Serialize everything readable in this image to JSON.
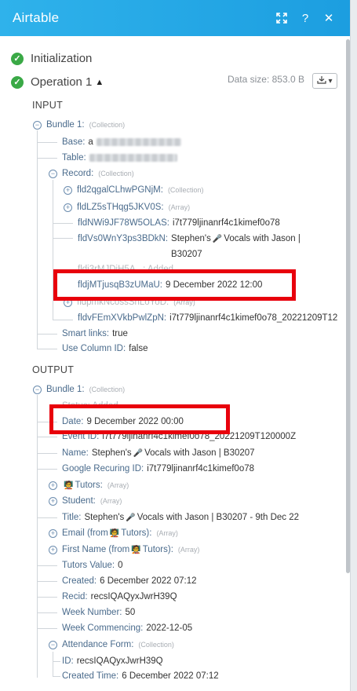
{
  "titlebar": {
    "title": "Airtable",
    "expand_icon": "expand-icon",
    "help_label": "?",
    "close_label": "✕"
  },
  "initialization": "Initialization",
  "operation": {
    "label": "Operation 1",
    "caret": "▲",
    "datasize": "Data size: 853.0 B"
  },
  "input": {
    "header": "INPUT",
    "bundle": "Bundle 1:",
    "collection": "(Collection)",
    "array": "(Array)",
    "base_key": "Base:",
    "base_val": "a",
    "table_key": "Table:",
    "record": "Record:",
    "f1": "fld2qgalCLhwPGNjM:",
    "f2": "fldLZ5sTHqg5JKV0S:",
    "f3_key": "fldNWi9JF78W5OLAS:",
    "f3_val": "i7t779ljinanrf4c1kimef0o78",
    "f4_key": "fldVs0WnY3ps3BDkN:",
    "f4_val1": "Stephen's",
    "f4_val2": "Vocals with Jason |",
    "f4_val3": "B30207",
    "f5_ghost": "fldi3rMJDiH5A...: Added",
    "f6_key": "fldjMTjusqB3zUMaU:",
    "f6_val": "9 December 2022 12:00",
    "f7_ghost": "fldpmkNcossShLoYoD:",
    "f8_key": "fldvFEmXVkbPwlZpN:",
    "f8_val": "i7t779ljinanrf4c1kimef0o78_20221209T12",
    "smart_key": "Smart links:",
    "smart_val": "true",
    "usecol_key": "Use Column ID:",
    "usecol_val": "false"
  },
  "output": {
    "header": "OUTPUT",
    "bundle": "Bundle 1:",
    "collection": "(Collection)",
    "array": "(Array)",
    "status_ghost": "Status: Added",
    "date_key": "Date:",
    "date_val": "9 December 2022 00:00",
    "event_key": "Event ID:",
    "event_val": "i7t779ljinanrf4c1kimef0o78_20221209T120000Z",
    "name_key": "Name:",
    "name_val1": "Stephen's",
    "name_val2": "Vocals with Jason | B30207",
    "grec_key": "Google Recuring ID:",
    "grec_val": "i7t779ljinanrf4c1kimef0o78",
    "tutors_key": "Tutors:",
    "student_key": "Student:",
    "title_key": "Title:",
    "title_val1": "Stephen's",
    "title_val2": "Vocals with Jason | B30207 - 9th Dec 22",
    "email_key1": "Email (from",
    "email_key2": "Tutors):",
    "fname_key1": "First Name (from",
    "fname_key2": "Tutors):",
    "tval_key": "Tutors Value:",
    "tval_val": "0",
    "created_key": "Created:",
    "created_val": "6 December 2022 07:12",
    "recid_key": "Recid:",
    "recid_val": "recsIQAQyxJwrH39Q",
    "week_key": "Week Number:",
    "week_val": "50",
    "weekc_key": "Week Commencing:",
    "weekc_val": "2022-12-05",
    "att_key": "Attendance Form:",
    "id_key": "ID:",
    "id_val": "recsIQAQyxJwrH39Q",
    "ct_key": "Created Time:",
    "ct_val": "6 December 2022 07:12"
  }
}
